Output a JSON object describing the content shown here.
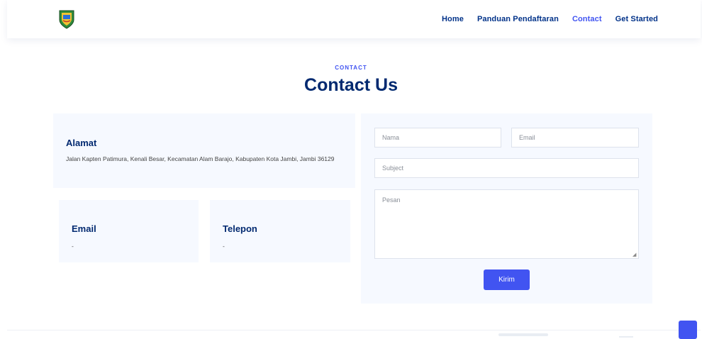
{
  "header": {
    "logo_name": "coat-of-arms-logo",
    "nav": [
      {
        "label": "Home",
        "active": false
      },
      {
        "label": "Panduan Pendaftaran",
        "active": false
      },
      {
        "label": "Contact",
        "active": true
      },
      {
        "label": "Get Started",
        "active": false
      }
    ]
  },
  "section": {
    "label": "CONTACT",
    "title": "Contact Us"
  },
  "info": {
    "alamat": {
      "heading": "Alamat",
      "text": "Jalan Kapten Patimura, Kenali Besar, Kecamatan Alam Barajo, Kabupaten Kota Jambi, Jambi 36129"
    },
    "email": {
      "heading": "Email",
      "value": "-"
    },
    "telepon": {
      "heading": "Telepon",
      "value": "-"
    }
  },
  "form": {
    "nama_placeholder": "Nama",
    "email_placeholder": "Email",
    "subject_placeholder": "Subject",
    "pesan_placeholder": "Pesan",
    "submit_label": "Kirim"
  },
  "colors": {
    "accent": "#4154f1",
    "heading": "#012970",
    "box_bg": "#f6f9ff"
  },
  "icons": {
    "back_to_top": "arrow-up-icon"
  }
}
